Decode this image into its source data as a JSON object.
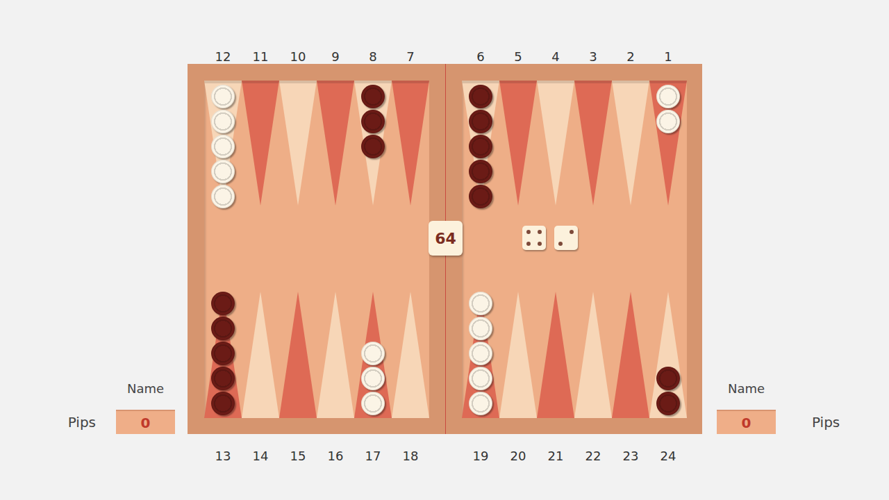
{
  "board": {
    "top": [
      {
        "number": "12",
        "color": "#f7d6b7",
        "checkers": 5,
        "checker_color": "#fbf4e6"
      },
      {
        "number": "11",
        "color": "#de6a55",
        "checkers": 0,
        "checker_color": null
      },
      {
        "number": "10",
        "color": "#f7d6b7",
        "checkers": 0,
        "checker_color": null
      },
      {
        "number": "9",
        "color": "#de6a55",
        "checkers": 0,
        "checker_color": null
      },
      {
        "number": "8",
        "color": "#f7d6b7",
        "checkers": 3,
        "checker_color": "#6b1b16"
      },
      {
        "number": "7",
        "color": "#de6a55",
        "checkers": 0,
        "checker_color": null
      },
      {
        "number": "6",
        "color": "#f7d6b7",
        "checkers": 5,
        "checker_color": "#6b1b16"
      },
      {
        "number": "5",
        "color": "#de6a55",
        "checkers": 0,
        "checker_color": null
      },
      {
        "number": "4",
        "color": "#f7d6b7",
        "checkers": 0,
        "checker_color": null
      },
      {
        "number": "3",
        "color": "#de6a55",
        "checkers": 0,
        "checker_color": null
      },
      {
        "number": "2",
        "color": "#f7d6b7",
        "checkers": 0,
        "checker_color": null
      },
      {
        "number": "1",
        "color": "#de6a55",
        "checkers": 2,
        "checker_color": "#fbf4e6"
      }
    ],
    "bottom": [
      {
        "number": "13",
        "color": "#de6a55",
        "checkers": 5,
        "checker_color": "#6b1b16"
      },
      {
        "number": "14",
        "color": "#f7d6b7",
        "checkers": 0,
        "checker_color": null
      },
      {
        "number": "15",
        "color": "#de6a55",
        "checkers": 0,
        "checker_color": null
      },
      {
        "number": "16",
        "color": "#f7d6b7",
        "checkers": 0,
        "checker_color": null
      },
      {
        "number": "17",
        "color": "#de6a55",
        "checkers": 3,
        "checker_color": "#fbf4e6"
      },
      {
        "number": "18",
        "color": "#f7d6b7",
        "checkers": 0,
        "checker_color": null
      },
      {
        "number": "19",
        "color": "#de6a55",
        "checkers": 5,
        "checker_color": "#fbf4e6"
      },
      {
        "number": "20",
        "color": "#f7d6b7",
        "checkers": 0,
        "checker_color": null
      },
      {
        "number": "21",
        "color": "#de6a55",
        "checkers": 0,
        "checker_color": null
      },
      {
        "number": "22",
        "color": "#f7d6b7",
        "checkers": 0,
        "checker_color": null
      },
      {
        "number": "23",
        "color": "#de6a55",
        "checkers": 0,
        "checker_color": null
      },
      {
        "number": "24",
        "color": "#f7d6b7",
        "checkers": 2,
        "checker_color": "#6b1b16"
      }
    ]
  },
  "doubling_cube": {
    "value": "64"
  },
  "dice": [
    {
      "value": 4
    },
    {
      "value": 2
    }
  ],
  "players": [
    {
      "name_label": "Name",
      "pips_label": "Pips",
      "pips": "0"
    },
    {
      "name_label": "Name",
      "pips_label": "Pips",
      "pips": "0"
    }
  ]
}
